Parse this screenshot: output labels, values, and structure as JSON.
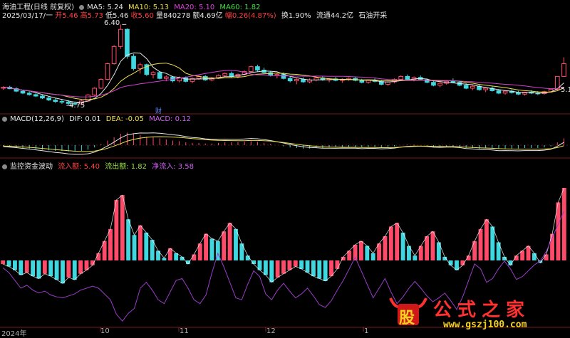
{
  "price_panel": {
    "title": "海油工程(日线 前复权)",
    "date": "2025/03/17/一",
    "open": "开5.46",
    "high": "高5.73",
    "low": "低5.46",
    "close": "收5.60",
    "volume": "量840278",
    "amount": "额4.69亿",
    "change": "幅0.26(4.87%)",
    "turnover": "换1.90%",
    "float": "流通44.2亿",
    "sector": "石油开采",
    "ma5": "MA5: 5.24",
    "ma10": "MA10: 5.13",
    "ma20": "MA20: 5.10",
    "ma60": "MA60: 1.82",
    "peak_label": "6.40",
    "low_label": "4.75",
    "right_label": "5.1",
    "fin_marker": "财"
  },
  "macd_panel": {
    "title": "MACD(12,26,9)",
    "dif": "DIF: 0.01",
    "dea": "DEA: -0.05",
    "macd": "MACD: 0.12"
  },
  "flow_panel": {
    "title": "监控资金波动",
    "inflow": "流入额: 5.40",
    "outflow": "流出额: 1.82",
    "net": "净流入: 3.58"
  },
  "time_axis": [
    "2024年",
    "10",
    "11",
    "12",
    "1"
  ],
  "watermark": {
    "logo_text": "股",
    "site_name": "公式之家",
    "url": "www.gszj100.com"
  },
  "colors": {
    "up": "#ff4a6a",
    "down": "#3fd7e0",
    "ma5": "#e6e6e6",
    "ma10": "#f0e04a",
    "ma20": "#d040d0",
    "grid": "#7a1a1a",
    "flow_line": "#9a3cc8"
  },
  "chart_data": {
    "type": "candlestick",
    "candles": [
      [
        5.1,
        5.14,
        5.07,
        5.12
      ],
      [
        5.12,
        5.15,
        5.08,
        5.09
      ],
      [
        5.09,
        5.12,
        5.02,
        5.04
      ],
      [
        5.04,
        5.07,
        4.98,
        5.0
      ],
      [
        5.0,
        5.03,
        4.95,
        4.97
      ],
      [
        4.97,
        5.0,
        4.92,
        4.94
      ],
      [
        4.94,
        4.97,
        4.88,
        4.9
      ],
      [
        4.9,
        4.93,
        4.84,
        4.86
      ],
      [
        4.86,
        4.9,
        4.8,
        4.83
      ],
      [
        4.83,
        4.88,
        4.78,
        4.82
      ],
      [
        4.82,
        4.86,
        4.76,
        4.79
      ],
      [
        4.79,
        4.83,
        4.75,
        4.78
      ],
      [
        4.78,
        4.86,
        4.76,
        4.84
      ],
      [
        4.84,
        4.98,
        4.82,
        4.96
      ],
      [
        4.96,
        5.12,
        4.94,
        5.1
      ],
      [
        5.1,
        5.3,
        5.08,
        5.28
      ],
      [
        5.28,
        5.62,
        5.26,
        5.6
      ],
      [
        5.6,
        5.98,
        5.58,
        5.95
      ],
      [
        5.95,
        6.4,
        5.9,
        6.3
      ],
      [
        6.3,
        6.32,
        5.7,
        5.75
      ],
      [
        5.75,
        5.8,
        5.46,
        5.5
      ],
      [
        5.5,
        5.62,
        5.4,
        5.58
      ],
      [
        5.58,
        5.6,
        5.35,
        5.38
      ],
      [
        5.38,
        5.45,
        5.3,
        5.42
      ],
      [
        5.42,
        5.44,
        5.28,
        5.3
      ],
      [
        5.3,
        5.36,
        5.24,
        5.33
      ],
      [
        5.33,
        5.35,
        5.22,
        5.25
      ],
      [
        5.25,
        5.34,
        5.22,
        5.31
      ],
      [
        5.31,
        5.34,
        5.22,
        5.24
      ],
      [
        5.24,
        5.32,
        5.2,
        5.3
      ],
      [
        5.3,
        5.36,
        5.27,
        5.34
      ],
      [
        5.34,
        5.37,
        5.25,
        5.27
      ],
      [
        5.27,
        5.33,
        5.24,
        5.31
      ],
      [
        5.31,
        5.38,
        5.29,
        5.36
      ],
      [
        5.36,
        5.42,
        5.33,
        5.4
      ],
      [
        5.4,
        5.44,
        5.32,
        5.34
      ],
      [
        5.34,
        5.4,
        5.3,
        5.38
      ],
      [
        5.38,
        5.46,
        5.36,
        5.44
      ],
      [
        5.44,
        5.56,
        5.42,
        5.54
      ],
      [
        5.54,
        5.58,
        5.44,
        5.47
      ],
      [
        5.47,
        5.52,
        5.4,
        5.42
      ],
      [
        5.42,
        5.45,
        5.34,
        5.36
      ],
      [
        5.36,
        5.4,
        5.3,
        5.38
      ],
      [
        5.38,
        5.42,
        5.28,
        5.3
      ],
      [
        5.3,
        5.34,
        5.22,
        5.25
      ],
      [
        5.25,
        5.3,
        5.18,
        5.28
      ],
      [
        5.28,
        5.32,
        5.21,
        5.23
      ],
      [
        5.23,
        5.3,
        5.2,
        5.27
      ],
      [
        5.27,
        5.33,
        5.24,
        5.31
      ],
      [
        5.31,
        5.34,
        5.25,
        5.27
      ],
      [
        5.27,
        5.31,
        5.22,
        5.29
      ],
      [
        5.29,
        5.33,
        5.24,
        5.26
      ],
      [
        5.26,
        5.3,
        5.21,
        5.28
      ],
      [
        5.28,
        5.32,
        5.25,
        5.3
      ],
      [
        5.3,
        5.34,
        5.24,
        5.26
      ],
      [
        5.26,
        5.29,
        5.2,
        5.22
      ],
      [
        5.22,
        5.28,
        5.19,
        5.26
      ],
      [
        5.26,
        5.3,
        5.22,
        5.24
      ],
      [
        5.24,
        5.27,
        5.16,
        5.18
      ],
      [
        5.18,
        5.25,
        5.15,
        5.23
      ],
      [
        5.23,
        5.3,
        5.2,
        5.28
      ],
      [
        5.28,
        5.36,
        5.26,
        5.34
      ],
      [
        5.34,
        5.38,
        5.26,
        5.28
      ],
      [
        5.28,
        5.34,
        5.24,
        5.32
      ],
      [
        5.32,
        5.36,
        5.26,
        5.27
      ],
      [
        5.27,
        5.3,
        5.2,
        5.22
      ],
      [
        5.22,
        5.26,
        5.14,
        5.16
      ],
      [
        5.16,
        5.22,
        5.12,
        5.2
      ],
      [
        5.2,
        5.26,
        5.17,
        5.24
      ],
      [
        5.24,
        5.3,
        5.2,
        5.22
      ],
      [
        5.22,
        5.25,
        5.14,
        5.16
      ],
      [
        5.16,
        5.2,
        5.08,
        5.1
      ],
      [
        5.1,
        5.16,
        5.06,
        5.14
      ],
      [
        5.14,
        5.18,
        5.05,
        5.07
      ],
      [
        5.07,
        5.12,
        5.02,
        5.1
      ],
      [
        5.1,
        5.14,
        5.03,
        5.05
      ],
      [
        5.05,
        5.08,
        4.98,
        5.0
      ],
      [
        5.0,
        5.06,
        4.97,
        5.04
      ],
      [
        5.04,
        5.08,
        4.99,
        5.01
      ],
      [
        5.01,
        5.05,
        4.96,
        4.98
      ],
      [
        4.98,
        5.03,
        4.95,
        5.02
      ],
      [
        5.02,
        5.06,
        4.98,
        5.0
      ],
      [
        5.0,
        5.04,
        4.96,
        4.99
      ],
      [
        4.99,
        5.05,
        4.97,
        5.03
      ],
      [
        5.03,
        5.1,
        5.01,
        5.08
      ],
      [
        5.08,
        5.34,
        5.06,
        5.34
      ],
      [
        5.34,
        5.73,
        5.33,
        5.6
      ]
    ],
    "macd_hist": [
      -0.02,
      -0.03,
      -0.04,
      -0.05,
      -0.06,
      -0.07,
      -0.08,
      -0.09,
      -0.1,
      -0.1,
      -0.11,
      -0.11,
      -0.1,
      -0.08,
      -0.04,
      0.02,
      0.08,
      0.14,
      0.2,
      0.22,
      0.2,
      0.18,
      0.15,
      0.14,
      0.12,
      0.1,
      0.08,
      0.07,
      0.05,
      0.04,
      0.04,
      0.03,
      0.03,
      0.04,
      0.05,
      0.05,
      0.05,
      0.06,
      0.07,
      0.06,
      0.04,
      0.02,
      0.0,
      -0.02,
      -0.04,
      -0.05,
      -0.06,
      -0.06,
      -0.05,
      -0.05,
      -0.04,
      -0.04,
      -0.03,
      -0.03,
      -0.03,
      -0.04,
      -0.03,
      -0.03,
      -0.04,
      -0.03,
      -0.02,
      0.0,
      0.01,
      0.01,
      0.0,
      -0.01,
      -0.03,
      -0.03,
      -0.02,
      -0.02,
      -0.03,
      -0.05,
      -0.05,
      -0.06,
      -0.05,
      -0.06,
      -0.07,
      -0.06,
      -0.06,
      -0.06,
      -0.05,
      -0.05,
      -0.05,
      -0.04,
      -0.02,
      0.05,
      0.12
    ],
    "flow_values": [
      -0.3,
      -0.5,
      -0.8,
      -1.2,
      -1.0,
      -1.3,
      -1.5,
      -1.1,
      -1.3,
      -1.6,
      -1.9,
      -1.4,
      -1.6,
      -1.1,
      -0.8,
      -0.4,
      0.6,
      1.6,
      2.6,
      5.0,
      5.4,
      3.4,
      2.1,
      2.9,
      2.3,
      1.7,
      0.8,
      0.2,
      1.0,
      0.6,
      0.3,
      -0.3,
      0.5,
      1.4,
      2.2,
      1.8,
      1.6,
      2.4,
      3.1,
      2.6,
      1.4,
      0.4,
      -0.3,
      -0.8,
      -1.2,
      -1.8,
      -1.4,
      -1.1,
      -0.8,
      -0.5,
      -0.7,
      -1.0,
      -1.3,
      -1.5,
      -1.7,
      -1.3,
      -0.7,
      0.3,
      0.8,
      1.3,
      1.6,
      1.2,
      0.6,
      1.4,
      2.0,
      2.8,
      3.1,
      2.3,
      1.2,
      0.4,
      1.2,
      2.0,
      2.4,
      1.5,
      0.3,
      -0.4,
      -0.8,
      -0.4,
      0.4,
      1.6,
      2.6,
      3.4,
      2.8,
      1.5,
      0.3,
      -0.4,
      0.4,
      0.8,
      1.2,
      0.6,
      -0.2,
      0.5,
      2.2,
      4.8,
      6.0
    ],
    "flow_line": [
      -1.5,
      -2.0,
      -2.8,
      -3.6,
      -3.3,
      -3.8,
      -4.1,
      -3.9,
      -4.3,
      -4.5,
      -4.6,
      -4.4,
      -4.2,
      -3.8,
      -3.6,
      -3.4,
      -3.6,
      -4.2,
      -4.8,
      -6.3,
      -7.0,
      -6.2,
      -5.7,
      -3.6,
      -3.0,
      -3.8,
      -4.8,
      -5.2,
      -4.0,
      -2.8,
      -2.6,
      -3.6,
      -4.8,
      -5.2,
      -4.3,
      -2.0,
      0.0,
      -1.4,
      -3.0,
      -4.6,
      -4.8,
      -3.2,
      -1.8,
      -2.4,
      -4.2,
      -4.8,
      -3.8,
      -3.1,
      -3.9,
      -4.6,
      -4.2,
      -3.6,
      -4.4,
      -5.3,
      -5.6,
      -4.9,
      -3.8,
      -2.8,
      -1.6,
      -0.4,
      -1.8,
      -3.2,
      -4.6,
      -3.6,
      -2.6,
      -4.0,
      -5.2,
      -4.5,
      -3.6,
      -2.9,
      -3.6,
      -4.4,
      -5.0,
      -4.6,
      -4.1,
      -4.9,
      -5.8,
      -4.5,
      -2.8,
      -1.1,
      -1.6,
      -3.0,
      -2.6,
      -1.6,
      -0.8,
      -1.6,
      -2.7,
      -2.4,
      -1.8,
      -1.2,
      -0.8,
      0.2,
      1.6,
      3.0,
      4.4
    ]
  }
}
